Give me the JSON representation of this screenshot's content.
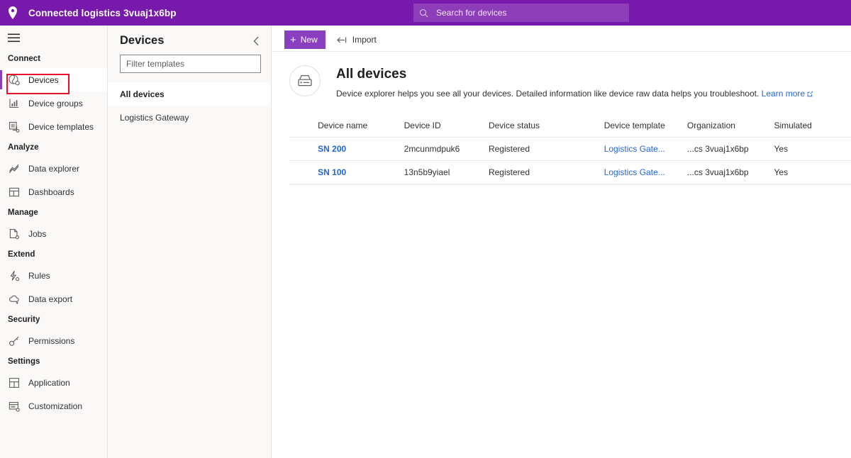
{
  "header": {
    "logo_icon": "location-pin-icon",
    "title": "Connected logistics 3vuaj1x6bp",
    "search": {
      "icon": "search-icon",
      "placeholder": "Search for devices",
      "value": ""
    },
    "bg_color": "#7719aa"
  },
  "sidebar": {
    "menu_icon": "hamburger-menu-icon",
    "groups": [
      {
        "label": "Connect",
        "items": [
          {
            "label": "Devices",
            "icon": "devices-icon",
            "selected": true,
            "highlighted": true
          },
          {
            "label": "Device groups",
            "icon": "device-groups-icon",
            "selected": false,
            "highlighted": false
          },
          {
            "label": "Device templates",
            "icon": "device-templates-icon",
            "selected": false,
            "highlighted": false
          }
        ]
      },
      {
        "label": "Analyze",
        "items": [
          {
            "label": "Data explorer",
            "icon": "chart-line-icon",
            "selected": false,
            "highlighted": false
          },
          {
            "label": "Dashboards",
            "icon": "dashboard-grid-icon",
            "selected": false,
            "highlighted": false
          }
        ]
      },
      {
        "label": "Manage",
        "items": [
          {
            "label": "Jobs",
            "icon": "jobs-page-icon",
            "selected": false,
            "highlighted": false
          }
        ]
      },
      {
        "label": "Extend",
        "items": [
          {
            "label": "Rules",
            "icon": "rules-lightning-icon",
            "selected": false,
            "highlighted": false
          },
          {
            "label": "Data export",
            "icon": "cloud-export-icon",
            "selected": false,
            "highlighted": false
          }
        ]
      },
      {
        "label": "Security",
        "items": [
          {
            "label": "Permissions",
            "icon": "key-icon",
            "selected": false,
            "highlighted": false
          }
        ]
      },
      {
        "label": "Settings",
        "items": [
          {
            "label": "Application",
            "icon": "application-layout-icon",
            "selected": false,
            "highlighted": false
          },
          {
            "label": "Customization",
            "icon": "customization-icon",
            "selected": false,
            "highlighted": false
          }
        ]
      }
    ],
    "highlight_color": "#e8112d",
    "selected_indicator_color": "#8a3fc0"
  },
  "devices_pane": {
    "title": "Devices",
    "collapse_icon": "chevron-left-icon",
    "filter": {
      "placeholder": "Filter templates",
      "value": ""
    },
    "templates": [
      {
        "label": "All devices",
        "selected": true
      },
      {
        "label": "Logistics Gateway",
        "selected": false
      }
    ]
  },
  "command_bar": {
    "new_label": "New",
    "new_icon": "plus-icon",
    "import_label": "Import",
    "import_icon": "import-arrow-icon",
    "new_button_color": "#8a3fc0"
  },
  "page": {
    "icon": "device-explorer-icon",
    "title": "All devices",
    "subtitle": "Device explorer helps you see all your devices. Detailed information like device raw data helps you troubleshoot.",
    "learn_more_label": "Learn more",
    "learn_more_icon": "external-link-icon",
    "link_color": "#2266dd"
  },
  "table": {
    "columns": [
      "Device name",
      "Device ID",
      "Device status",
      "Device template",
      "Organization",
      "Simulated"
    ],
    "rows": [
      {
        "device_name": "SN 200",
        "device_id": "2mcunmdpuk6",
        "device_status": "Registered",
        "device_template": "Logistics Gate...",
        "organization": "...cs 3vuaj1x6bp",
        "simulated": "Yes"
      },
      {
        "device_name": "SN 100",
        "device_id": "13n5b9yiael",
        "device_status": "Registered",
        "device_template": "Logistics Gate...",
        "organization": "...cs 3vuaj1x6bp",
        "simulated": "Yes"
      }
    ]
  }
}
